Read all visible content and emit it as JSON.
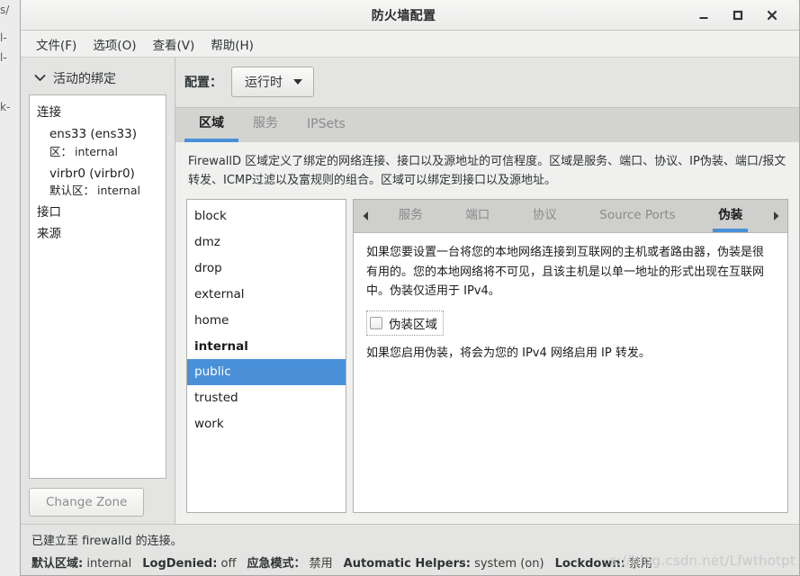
{
  "desktop": {
    "background_fragments": [
      "s/",
      "l-",
      "l-",
      "k-"
    ]
  },
  "window": {
    "title": "防火墙配置",
    "controls": {
      "minimize": "minimize-icon",
      "maximize": "maximize-icon",
      "close": "close-icon"
    }
  },
  "menubar": {
    "items": [
      {
        "label": "文件(F)"
      },
      {
        "label": "选项(O)"
      },
      {
        "label": "查看(V)"
      },
      {
        "label": "帮助(H)"
      }
    ]
  },
  "sidebar": {
    "expander": {
      "label": "活动的绑定",
      "icon": "chevron-down-icon",
      "expanded": true
    },
    "groups": [
      {
        "title": "连接",
        "entries": [
          {
            "name": "ens33 (ens33)",
            "key": "区：",
            "value": "internal"
          },
          {
            "name": "virbr0 (virbr0)",
            "key": "默认区：",
            "value": "internal"
          }
        ]
      },
      {
        "title": "接口",
        "entries": []
      },
      {
        "title": "来源",
        "entries": []
      }
    ],
    "change_zone_button": "Change Zone"
  },
  "configbar": {
    "label": "配置：",
    "selected": "运行时",
    "caret": "caret-down-icon"
  },
  "top_tabs": [
    {
      "label": "区域",
      "active": true
    },
    {
      "label": "服务",
      "active": false
    },
    {
      "label": "IPSets",
      "active": false
    }
  ],
  "description": "FirewallD 区域定义了绑定的网络连接、接口以及源地址的可信程度。区域是服务、端口、协议、IP伪装、端口/报文转发、ICMP过滤以及富规则的组合。区域可以绑定到接口以及源地址。",
  "zone_list": [
    {
      "name": "block",
      "selected": false,
      "bold": false
    },
    {
      "name": "dmz",
      "selected": false,
      "bold": false
    },
    {
      "name": "drop",
      "selected": false,
      "bold": false
    },
    {
      "name": "external",
      "selected": false,
      "bold": false
    },
    {
      "name": "home",
      "selected": false,
      "bold": false
    },
    {
      "name": "internal",
      "selected": false,
      "bold": true
    },
    {
      "name": "public",
      "selected": true,
      "bold": false
    },
    {
      "name": "trusted",
      "selected": false,
      "bold": false
    },
    {
      "name": "work",
      "selected": false,
      "bold": false
    }
  ],
  "sub_tabs": {
    "scroll_left": "arrow-left-icon",
    "scroll_right": "arrow-right-icon",
    "items": [
      {
        "label": "服务",
        "active": false
      },
      {
        "label": "端口",
        "active": false
      },
      {
        "label": "协议",
        "active": false
      },
      {
        "label": "Source Ports",
        "active": false
      },
      {
        "label": "伪装",
        "active": true
      }
    ]
  },
  "masquerade_panel": {
    "intro": "如果您要设置一台将您的本地网络连接到互联网的主机或者路由器，伪装是很有用的。您的本地网络将不可见，且该主机是以单一地址的形式出现在互联网中。伪装仅适用于 IPv4。",
    "checkbox_label": "伪装区域",
    "checkbox_checked": false,
    "note": "如果您启用伪装，将会为您的 IPv4 网络启用 IP 转发。"
  },
  "statusbar": {
    "connection_message": "已建立至 firewalld 的连接。",
    "items": [
      {
        "key": "默认区域:",
        "value": "internal"
      },
      {
        "key": "LogDenied:",
        "value": "off"
      },
      {
        "key": "应急模式：",
        "value": "禁用"
      },
      {
        "key": "Automatic Helpers:",
        "value": "system (on)"
      },
      {
        "key": "Lockdown:",
        "value": "禁用"
      }
    ]
  },
  "watermark": "s://blog.csdn.net/Lfwthotpt",
  "colors": {
    "accent": "#4a90d9",
    "window_bg": "#f0f0ef",
    "panel_bg": "#e4e4e2",
    "tabstrip_bg": "#d3d3d1"
  }
}
